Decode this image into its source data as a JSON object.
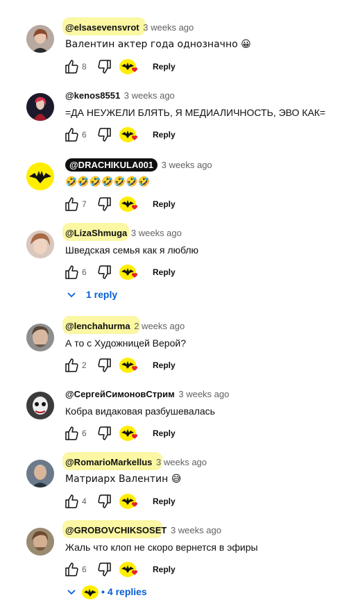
{
  "comments": [
    {
      "handle": "@elsasevensvrot",
      "time": "3 weeks ago",
      "text": "Валентин актер года однозначно 😀",
      "likes": "8",
      "reply": "Reply"
    },
    {
      "handle": "@kenos8551",
      "time": "3 weeks ago",
      "text": "=ДА НЕУЖЕЛИ БЛЯТЬ, Я МЕДИАЛИЧНОСТЬ, ЭВО КАК=",
      "likes": "6",
      "reply": "Reply"
    },
    {
      "handle": "@DRACHIKULA001",
      "time": "3 weeks ago",
      "text": "🤣🤣🤣🤣🤣🤣🤣",
      "likes": "7",
      "reply": "Reply"
    },
    {
      "handle": "@LizaShmuga",
      "time": "3 weeks ago",
      "text": "Шведская семья как я люблю",
      "likes": "6",
      "reply": "Reply",
      "replies": "1 reply"
    },
    {
      "handle": "@lenchahurma",
      "time": "2 weeks ago",
      "text": "А то с Художницей Верой?",
      "likes": "2",
      "reply": "Reply"
    },
    {
      "handle": "@СергейСимоновСтрим",
      "time": "3 weeks ago",
      "text": "Кобра видаковая разбушевалась",
      "likes": "6",
      "reply": "Reply"
    },
    {
      "handle": "@RomarioMarkellus",
      "time": "3 weeks ago",
      "text": "Матриарх Валентин 😅",
      "likes": "4",
      "reply": "Reply"
    },
    {
      "handle": "@GROBOVCHIKSOSET",
      "time": "3 weeks ago",
      "text": "Жаль что клоп не скоро вернется в эфиры",
      "likes": "6",
      "reply": "Reply",
      "replies": "4 replies"
    }
  ],
  "colors": {
    "accent": "#065fd4",
    "highlight": "#fbf7a3",
    "logo_yellow": "#ffee00",
    "heart": "#e2222a"
  }
}
